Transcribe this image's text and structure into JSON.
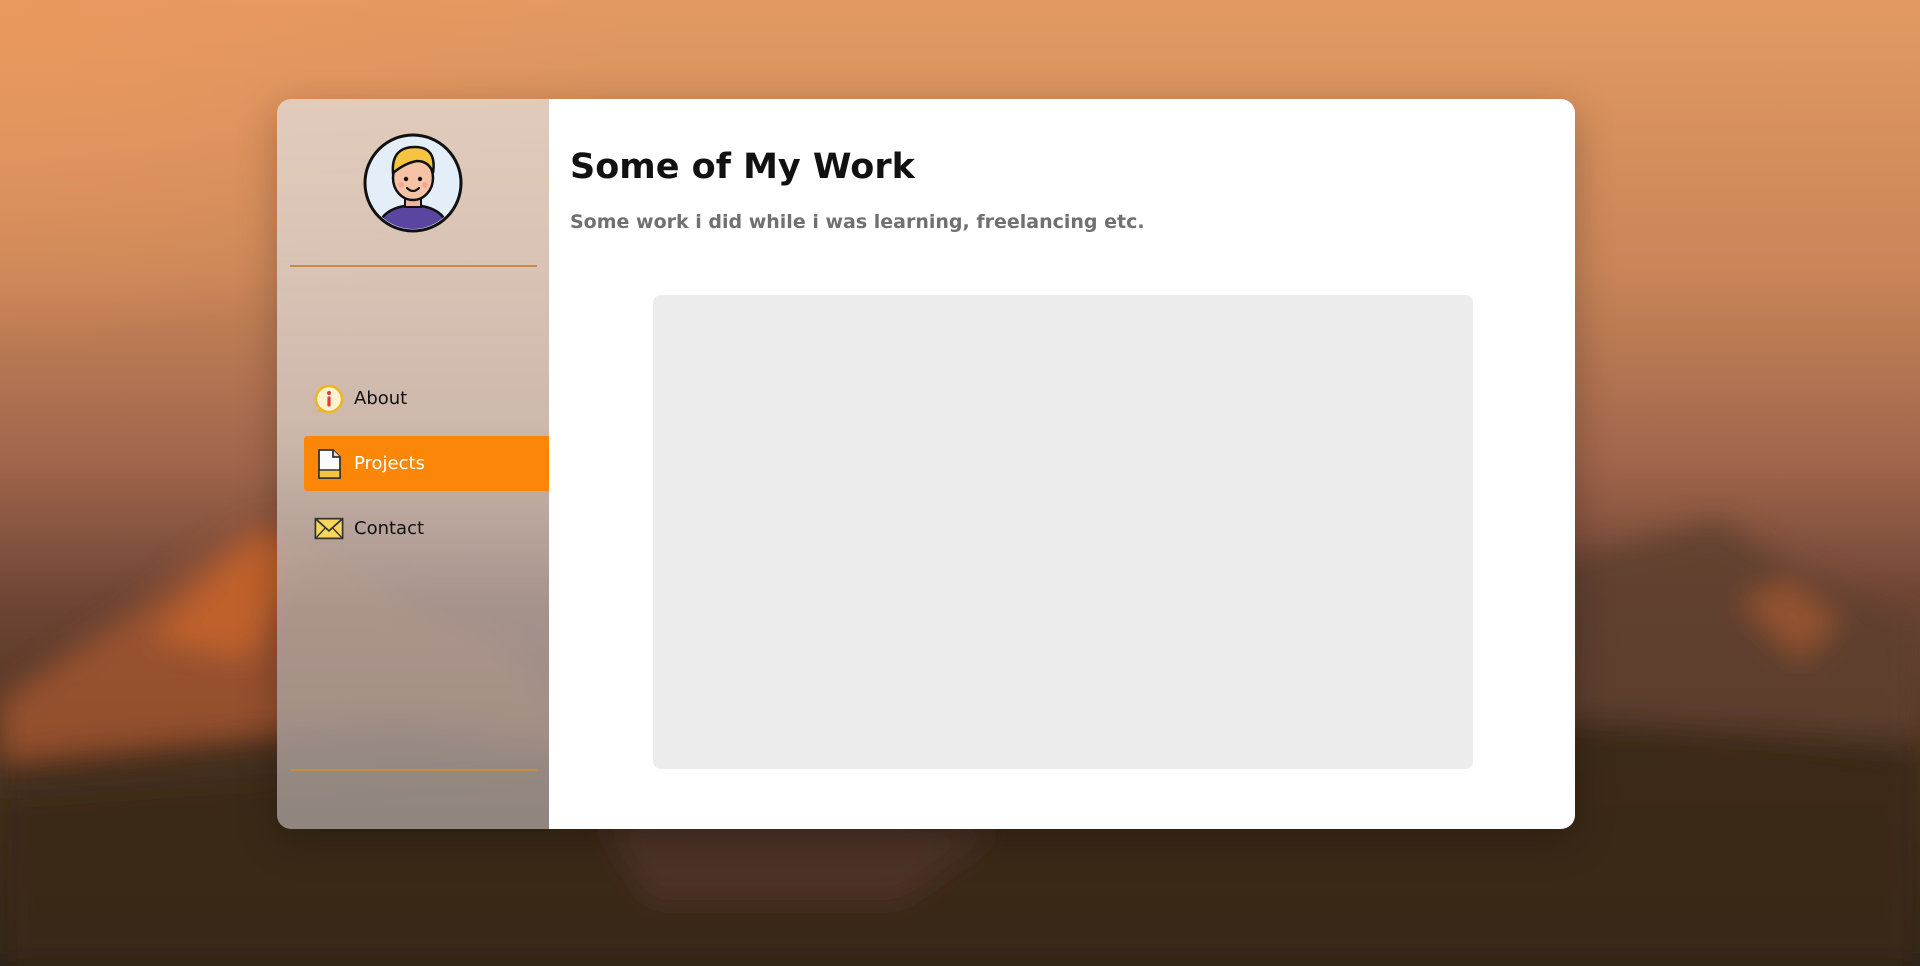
{
  "sidebar": {
    "avatar_icon": "avatar-boy-icon",
    "nav": [
      {
        "label": "About",
        "icon": "info-icon",
        "active": false
      },
      {
        "label": "Projects",
        "icon": "file-icon",
        "active": true
      },
      {
        "label": "Contact",
        "icon": "mail-icon",
        "active": false
      }
    ]
  },
  "main": {
    "title": "Some of My Work",
    "subtitle": "Some work i did while i was learning, freelancing etc."
  },
  "colors": {
    "accent": "#fb8607",
    "divider": "#c98a45",
    "placeholder": "#ececec"
  }
}
